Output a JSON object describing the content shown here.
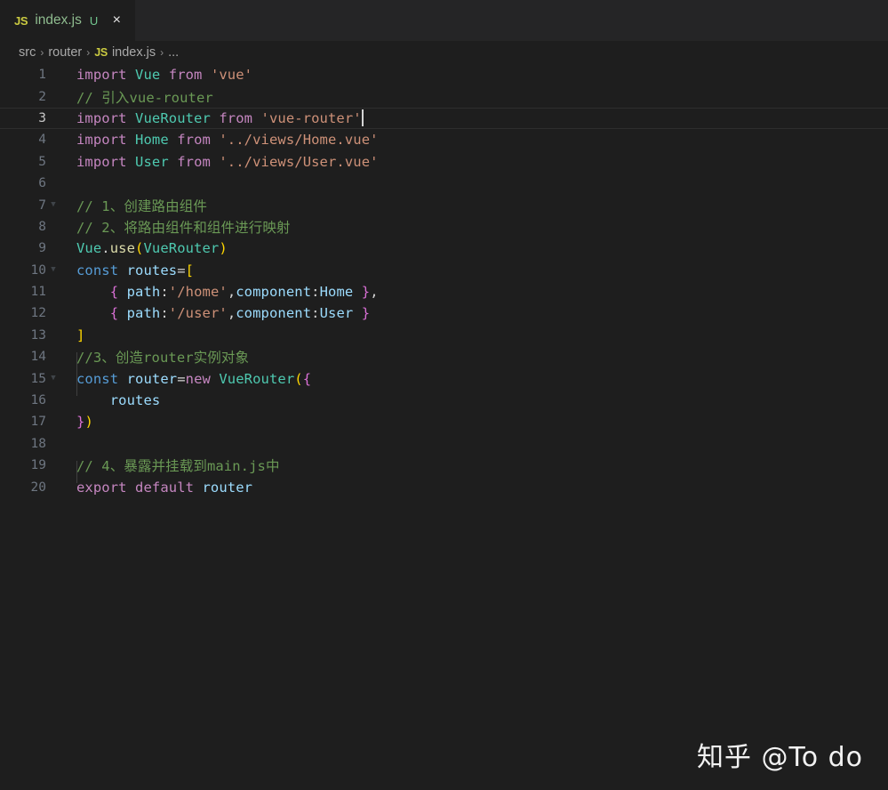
{
  "tab": {
    "icon_label": "JS",
    "filename": "index.js",
    "status_badge": "U",
    "close_label": "×"
  },
  "breadcrumbs": {
    "separator": "›",
    "items": [
      "src",
      "router"
    ],
    "file_icon": "JS",
    "file": "index.js",
    "overflow": "..."
  },
  "editor": {
    "language": "javascript",
    "active_line": 3,
    "cursor_line": 3,
    "cursor_column": 35,
    "total_lines": 20,
    "lines": [
      {
        "n": "1",
        "text": "import Vue from 'vue'"
      },
      {
        "n": "2",
        "text": "// 引入vue-router"
      },
      {
        "n": "3",
        "text": "import VueRouter from 'vue-router'"
      },
      {
        "n": "4",
        "text": "import Home from '../views/Home.vue'"
      },
      {
        "n": "5",
        "text": "import User from '../views/User.vue'"
      },
      {
        "n": "6",
        "text": ""
      },
      {
        "n": "7",
        "text": "// 1、创建路由组件"
      },
      {
        "n": "8",
        "text": "// 2、将路由组件和组件进行映射"
      },
      {
        "n": "9",
        "text": "Vue.use(VueRouter)"
      },
      {
        "n": "10",
        "text": "const routes=["
      },
      {
        "n": "11",
        "text": "    { path:'/home',component:Home },"
      },
      {
        "n": "12",
        "text": "    { path:'/user',component:User }"
      },
      {
        "n": "13",
        "text": "]"
      },
      {
        "n": "14",
        "text": "//3、创造router实例对象"
      },
      {
        "n": "15",
        "text": "const router=new VueRouter({"
      },
      {
        "n": "16",
        "text": "    routes"
      },
      {
        "n": "17",
        "text": "})"
      },
      {
        "n": "18",
        "text": ""
      },
      {
        "n": "19",
        "text": "// 4、暴露并挂载到main.js中"
      },
      {
        "n": "20",
        "text": "export default router"
      }
    ]
  },
  "watermark": {
    "text": "知乎 @To do"
  },
  "colors": {
    "editor_background": "#1e1e1e",
    "tabbar_background": "#252526",
    "keyword": "#c586c0",
    "const_keyword": "#569cd6",
    "variable": "#9cdcfe",
    "class": "#4ec9b0",
    "string": "#ce9178",
    "comment": "#6a9955",
    "function": "#dcdcaa",
    "bracket_level1": "#ffd700",
    "bracket_level2": "#da70d6",
    "bracket_level3": "#179fff",
    "line_number": "#6e7681",
    "active_line_number": "#c6c6c6",
    "tab_label": "#8fbc8f",
    "tab_badge": "#73c991",
    "js_icon": "#cbcb41"
  }
}
